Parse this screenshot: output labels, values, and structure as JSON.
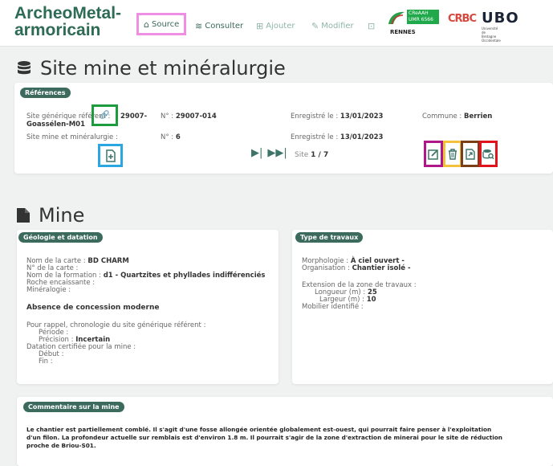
{
  "header": {
    "brand_line1": "ArcheoMetal-",
    "brand_line2": "armoricain",
    "nav": [
      {
        "label": "Source",
        "icon": "home-icon",
        "glyph": "⌂"
      },
      {
        "label": "Consulter",
        "icon": "database-icon",
        "glyph": "≋"
      },
      {
        "label": "Ajouter",
        "icon": "add-file-icon",
        "glyph": "⊞"
      },
      {
        "label": "Modifier",
        "icon": "edit-icon",
        "glyph": "✎"
      },
      {
        "label": "",
        "icon": "export-icon",
        "glyph": "⊡"
      }
    ],
    "logos": {
      "creaah": "CReAAH UMR 6566",
      "rennes": "RENNES",
      "crbc": "CRBC",
      "ubo": "UBO",
      "ubo_sub": "Université de Bretagne Occidentale"
    }
  },
  "site": {
    "title": "Site mine et minéralurgie",
    "references_badge": "Références",
    "row1": {
      "label": "Site générique référent :",
      "value_a": "29007-",
      "value_b": "Goassélen-M01",
      "num_label": "N° :",
      "num_value": "29007-014",
      "date_label": "Enregistré le :",
      "date_value": "13/01/2023",
      "commune_label": "Commune :",
      "commune_value": "Berrien"
    },
    "row2": {
      "label": "Site mine et minéralurgie :",
      "num_label": "N° :",
      "num_value": "6",
      "date_label": "Enregistré le :",
      "date_value": "13/01/2023"
    },
    "pager": {
      "next_glyph": "▶|",
      "last_glyph": "▶▶|",
      "label": "Site",
      "value": "1 / 7"
    }
  },
  "mine": {
    "title": "Mine",
    "geology": {
      "badge": "Géologie et datation",
      "map_label": "Nom de la carte :",
      "map_value": "BD CHARM",
      "map_num_label": "N° de la carte :",
      "formation_label": "Nom de la formation :",
      "formation_value": "d1 - Quartzites et phyllades indifférenciés",
      "roche_label": "Roche encaissante :",
      "mineralogie_label": "Minéralogie :",
      "concession": "Absence de concession moderne",
      "rappel": "Pour rappel, chronologie du site générique référent :",
      "periode_label": "Période :",
      "precision_label": "Précision :",
      "precision_value": "Incertain",
      "datation_label": "Datation certifiée pour la mine :",
      "debut_label": "Début :",
      "fin_label": "Fin :"
    },
    "works": {
      "badge": "Type de travaux",
      "morph_label": "Morphologie :",
      "morph_value": "À ciel ouvert -",
      "org_label": "Organisation :",
      "org_value": "Chantier isolé -",
      "ext_label": "Extension de la zone de travaux :",
      "long_label": "Longueur (m) :",
      "long_value": "25",
      "larg_label": "Largeur (m) :",
      "larg_value": "10",
      "mobilier_label": "Mobilier identifié :"
    },
    "comment": {
      "badge": "Commentaire sur la mine",
      "line1": "Le chantier est partiellement comblé. Il s'agit d'une fosse allongée orientée globalement est-ouest, qui pourrait faire penser à l'exploitation",
      "line2": "d'un filon. La profondeur actuelle sur remblais est d'environ 1.8 m. Il pourrait s'agir de la zone d'extraction de minerai pour le site de réduction",
      "line3": "proche de Briou-S01."
    }
  },
  "colors": {
    "brand": "#2e6b55",
    "badge": "#3c6b5d",
    "highlight_pink": "#ee8fe4",
    "highlight_green": "#1e9b3c",
    "highlight_blue": "#2aa6e0",
    "highlight_purple": "#b0188a",
    "highlight_yellow": "#f2c23a",
    "highlight_brown": "#7a3f14",
    "highlight_red": "#e0141c"
  }
}
